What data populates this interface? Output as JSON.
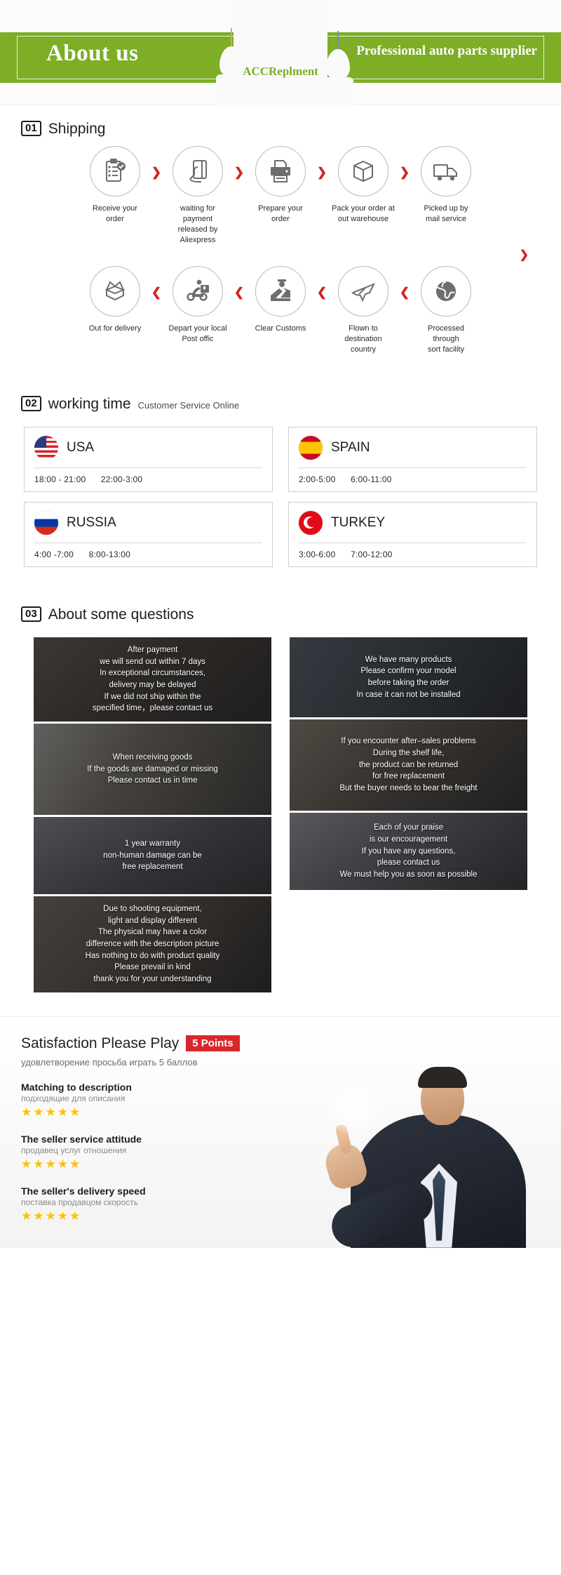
{
  "header": {
    "title": "About us",
    "subtitle": "Professional auto parts supplier",
    "brand": "ACCReplment"
  },
  "sections": {
    "shipping": {
      "num": "01",
      "title": "Shipping"
    },
    "working": {
      "num": "02",
      "title": "working time",
      "note": "Customer Service Online"
    },
    "questions": {
      "num": "03",
      "title": "About some questions"
    }
  },
  "shipping_steps_row1": [
    {
      "icon": "clipboard-check-icon",
      "label": "Receive your order"
    },
    {
      "icon": "hand-card-icon",
      "label": "waiting for payment\nreleased by Aliexpress"
    },
    {
      "icon": "printer-icon",
      "label": "Prepare your order"
    },
    {
      "icon": "package-box-icon",
      "label": "Pack your order at\nout warehouse"
    },
    {
      "icon": "truck-icon",
      "label": "Picked up by\nmail service"
    }
  ],
  "shipping_steps_row2": [
    {
      "icon": "open-box-icon",
      "label": "Out  for delivery"
    },
    {
      "icon": "scooter-courier-icon",
      "label": "Depart your local\nPost offic"
    },
    {
      "icon": "customs-officer-icon",
      "label": "Clear Customs"
    },
    {
      "icon": "airplane-icon",
      "label": "Flown to\ndestination country"
    },
    {
      "icon": "globe-icon",
      "label": "Processed through\nsort facility"
    }
  ],
  "arrows": {
    "right": "❯",
    "left": "❮",
    "down": "❯"
  },
  "working_time": [
    {
      "flag": "usa-flag-icon",
      "country": "USA",
      "hours": [
        "18:00 - 21:00",
        "22:00-3:00"
      ]
    },
    {
      "flag": "spain-flag-icon",
      "country": "SPAIN",
      "hours": [
        "2:00-5:00",
        "6:00-11:00"
      ]
    },
    {
      "flag": "russia-flag-icon",
      "country": "RUSSIA",
      "hours": [
        "4:00 -7:00",
        "8:00-13:00"
      ]
    },
    {
      "flag": "turkey-flag-icon",
      "country": "TURKEY",
      "hours": [
        "3:00-6:00",
        "7:00-12:00"
      ]
    }
  ],
  "questions_left": [
    "After payment\nwe will send out within 7 days\nIn exceptional circumstances,\ndelivery may be delayed\nIf we did not ship within the\nspecified time，please contact us",
    "When receiving goods\nIf the goods are damaged or missing\nPlease contact us in time",
    "1 year warranty\nnon-human damage can be\nfree replacement",
    "Due to shooting equipment,\nlight and display different\nThe physical may have a color\ndifference with the description picture\nHas nothing to do with product quality\nPlease prevail in kind\nthank you for your understanding"
  ],
  "questions_right": [
    "We have many products\nPlease confirm your model\nbefore taking the order\nIn case it can not be installed",
    "If you encounter after–sales problems\nDuring the shelf life,\nthe product can be returned\nfor free replacement\nBut the buyer needs to bear the freight",
    "Each of your praise\nis our encouragement\nIf you have any questions,\nplease contact us\nWe must help you as soon as possible"
  ],
  "satisfaction": {
    "title": "Satisfaction Please Play",
    "badge": "5 Points",
    "subtitle": "удовлетворение просьба играть 5 баллов",
    "stars": "★★★★★",
    "ratings": [
      {
        "en": "Matching to description",
        "ru": "подходящие для описания"
      },
      {
        "en": "The seller service attitude",
        "ru": "продавец услуг отношения"
      },
      {
        "en": "The seller's delivery speed",
        "ru": "поставка продавцом скорость"
      }
    ]
  },
  "colors": {
    "brand_green": "#7dae25",
    "arrow_red": "#d32222",
    "badge_red": "#d9262c",
    "star_gold": "#ffc107"
  }
}
